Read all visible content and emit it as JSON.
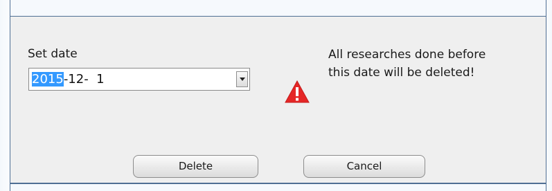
{
  "dialog": {
    "set_date_label": "Set date",
    "date_value": {
      "year": "2015",
      "rest": "-12-  1"
    },
    "warning_lines": [
      "All researches done before",
      "this date will be deleted!"
    ],
    "warning_icon": "warning-icon",
    "delete_label": "Delete",
    "cancel_label": "Cancel"
  },
  "colors": {
    "selection": "#3399ff",
    "warning": "#e52626",
    "frame": "#4f6f94",
    "body_bg": "#efefef"
  }
}
